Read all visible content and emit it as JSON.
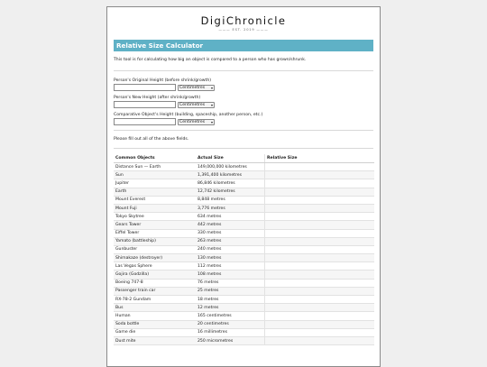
{
  "site": {
    "title": "DigiChronicle",
    "tagline": "——— EST. 2019 ———"
  },
  "calculator": {
    "title": "Relative Size Calculator",
    "intro": "This tool is for calculating how big an object is compared to a person who has grown/shrunk.",
    "fields": [
      {
        "label": "Person's Original Height (before shrink/growth)",
        "value": "",
        "unit": "Centimetres"
      },
      {
        "label": "Person's New Height (after shrink/growth)",
        "value": "",
        "unit": "Centimetres"
      },
      {
        "label": "Comparative Object's Height (building, spaceship, another person, etc.)",
        "value": "",
        "unit": "Centimetres"
      }
    ],
    "status": "Please fill out all of the above fields."
  },
  "table": {
    "headers": [
      "Common Objects",
      "Actual Size",
      "Relative Size"
    ],
    "rows": [
      {
        "object": "Distance Sun — Earth",
        "size": "149,000,000 kilometres",
        "relative": ""
      },
      {
        "object": "Sun",
        "size": "1,391,400 kilometres",
        "relative": ""
      },
      {
        "object": "Jupiter",
        "size": "86,846 kilometres",
        "relative": ""
      },
      {
        "object": "Earth",
        "size": "12,742 kilometres",
        "relative": ""
      },
      {
        "object": "Mount Everest",
        "size": "8,848 metres",
        "relative": ""
      },
      {
        "object": "Mount Fuji",
        "size": "3,776 metres",
        "relative": ""
      },
      {
        "object": "Tokyo Skytree",
        "size": "634 metres",
        "relative": ""
      },
      {
        "object": "Gears Tower",
        "size": "442 metres",
        "relative": ""
      },
      {
        "object": "Eiffel Tower",
        "size": "330 metres",
        "relative": ""
      },
      {
        "object": "Yamato (battleship)",
        "size": "263 metres",
        "relative": ""
      },
      {
        "object": "Gunbuster",
        "size": "240 metres",
        "relative": ""
      },
      {
        "object": "Shimakaze (destroyer)",
        "size": "130 metres",
        "relative": ""
      },
      {
        "object": "Las Vegas Sphere",
        "size": "112 metres",
        "relative": ""
      },
      {
        "object": "Gojira (Godzilla)",
        "size": "108 metres",
        "relative": ""
      },
      {
        "object": "Boeing 747-8",
        "size": "76 metres",
        "relative": ""
      },
      {
        "object": "Passenger train car",
        "size": "25 metres",
        "relative": ""
      },
      {
        "object": "RX-78-2 Gundam",
        "size": "18 metres",
        "relative": ""
      },
      {
        "object": "Bus",
        "size": "12 metres",
        "relative": ""
      },
      {
        "object": "Human",
        "size": "165 centimetres",
        "relative": ""
      },
      {
        "object": "Soda bottle",
        "size": "20 centimetres",
        "relative": ""
      },
      {
        "object": "Game die",
        "size": "16 millimetres",
        "relative": ""
      },
      {
        "object": "Dust mite",
        "size": "250 micrometres",
        "relative": ""
      }
    ]
  }
}
